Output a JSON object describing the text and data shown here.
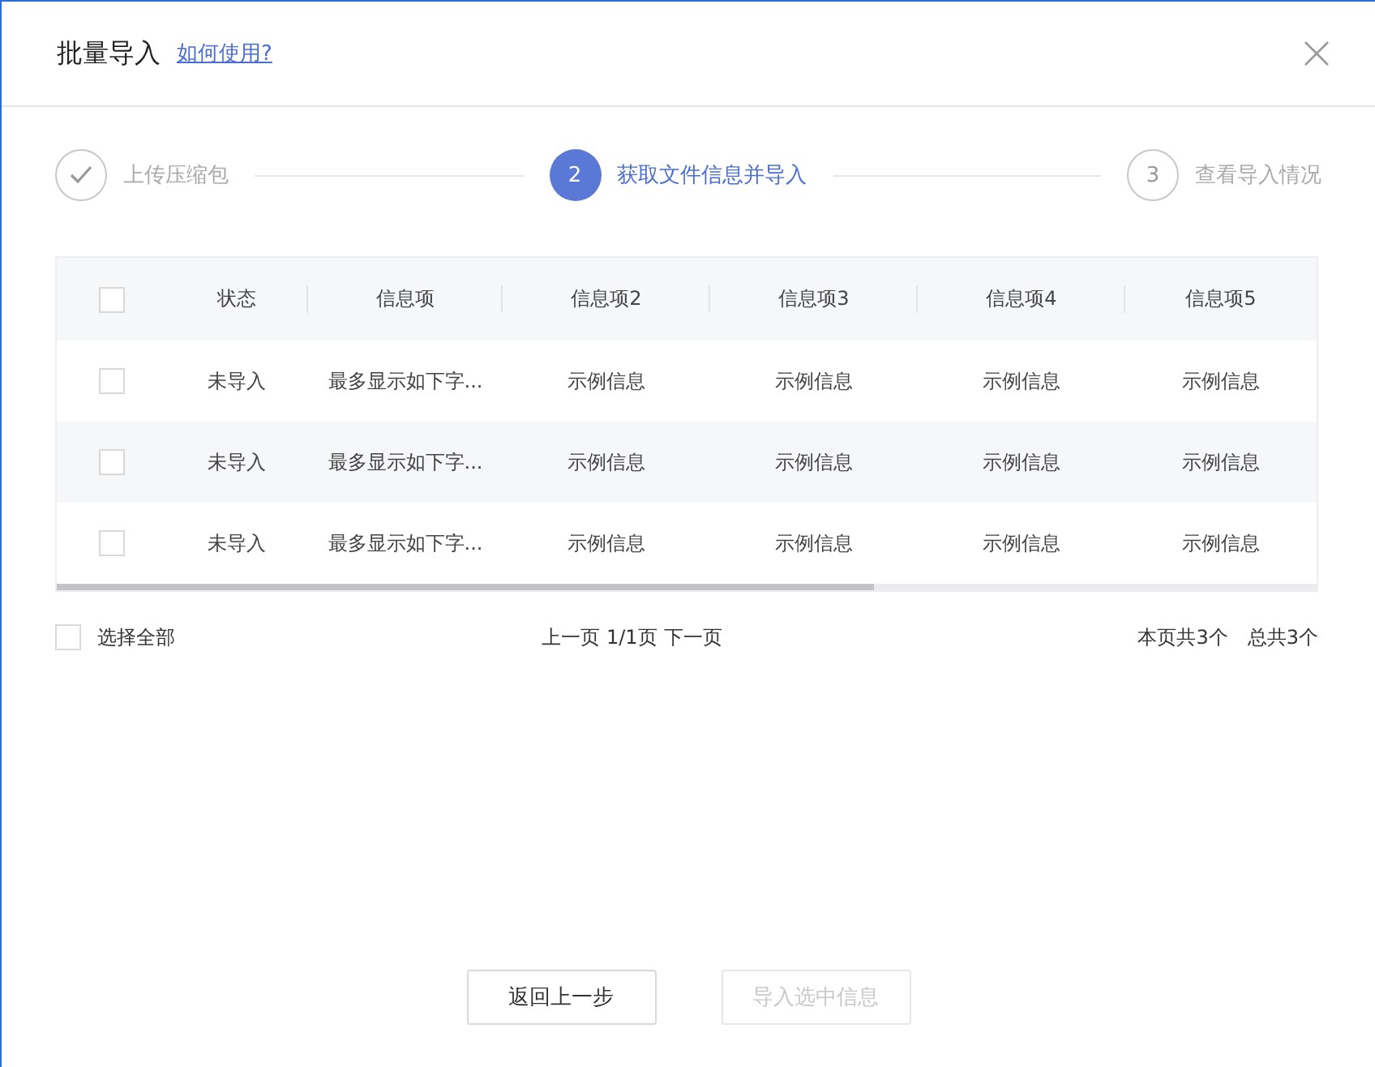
{
  "dialog": {
    "title": "批量导入",
    "help_link": "如何使用?"
  },
  "steps": [
    {
      "label": "上传压缩包",
      "done": true,
      "selected": false
    },
    {
      "number": "2",
      "label": "获取文件信息并导入",
      "done": false,
      "selected": true
    },
    {
      "number": "3",
      "label": "查看导入情况",
      "done": false,
      "selected": false
    }
  ],
  "table": {
    "header_checked": false,
    "columns": [
      "状态",
      "信息项",
      "信息项2",
      "信息项3",
      "信息项4",
      "信息项5"
    ],
    "rows": [
      {
        "checked": false,
        "cells": [
          "未导入",
          "最多显示如下字...",
          "示例信息",
          "示例信息",
          "示例信息",
          "示例信息"
        ]
      },
      {
        "checked": false,
        "cells": [
          "未导入",
          "最多显示如下字...",
          "示例信息",
          "示例信息",
          "示例信息",
          "示例信息"
        ]
      },
      {
        "checked": false,
        "cells": [
          "未导入",
          "最多显示如下字...",
          "示例信息",
          "示例信息",
          "示例信息",
          "示例信息"
        ]
      }
    ]
  },
  "footer": {
    "select_all": {
      "label": "选择全部",
      "checked": false
    },
    "prev": "上一页",
    "page": "1/1页",
    "next": "下一页",
    "page_count": "本页共3个",
    "total_count": "总共3个"
  },
  "buttons": [
    {
      "label": "返回上一步",
      "disabled": false
    },
    {
      "label": "导入选中信息",
      "disabled": true
    }
  ]
}
